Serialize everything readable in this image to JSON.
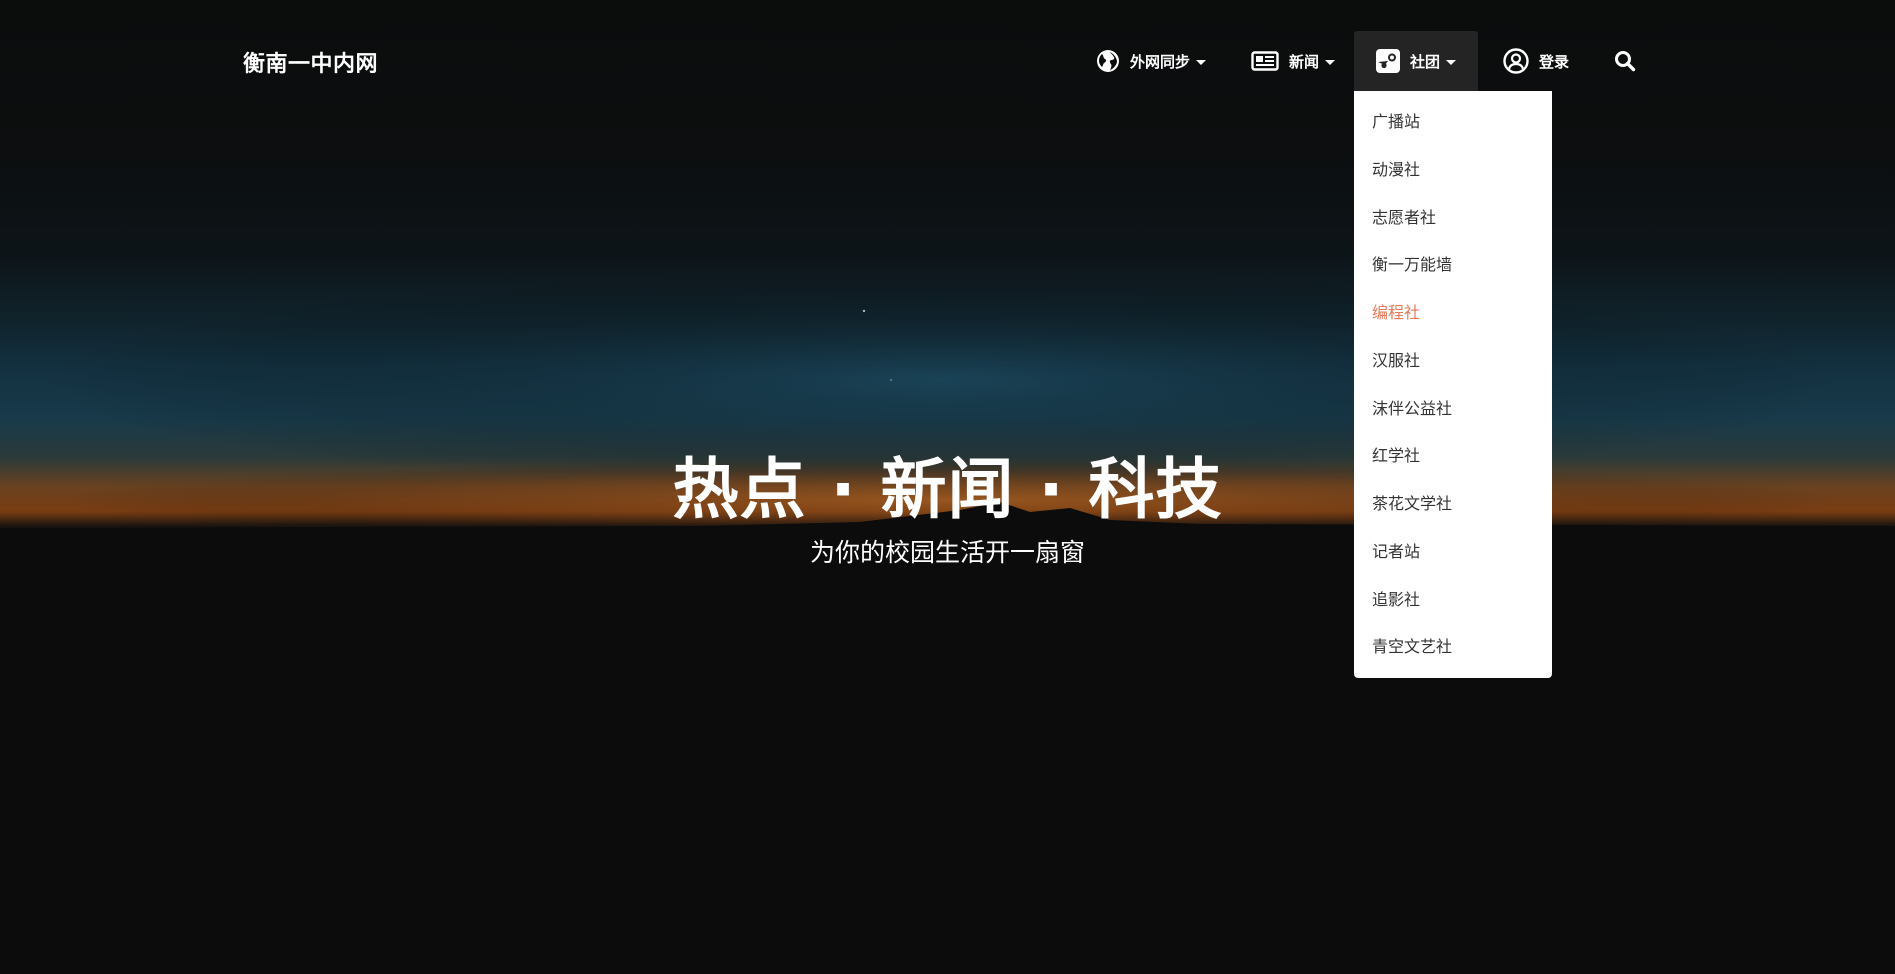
{
  "brand": {
    "title": "衡南一中内网"
  },
  "nav": {
    "items": [
      {
        "label": "外网同步",
        "icon": "globe-icon",
        "has_dropdown": true
      },
      {
        "label": "新闻",
        "icon": "newspaper-icon",
        "has_dropdown": true
      },
      {
        "label": "社团",
        "icon": "steam-icon",
        "has_dropdown": true,
        "active": true
      },
      {
        "label": "登录",
        "icon": "user-circle-icon",
        "has_dropdown": false
      }
    ],
    "search_icon": "search-icon"
  },
  "dropdown": {
    "items": [
      "广播站",
      "动漫社",
      "志愿者社",
      "衡一万能墙",
      "编程社",
      "汉服社",
      "沫伴公益社",
      "红学社",
      "茶花文学社",
      "记者站",
      "追影社",
      "青空文艺社"
    ],
    "highlighted_item": "编程社"
  },
  "hero": {
    "title": "热点 · 新闻 · 科技",
    "subtitle": "为你的校园生活开一扇窗"
  },
  "colors": {
    "background": "#0a0b0a",
    "active_nav_bg": "#232423",
    "dropdown_bg": "#ffffff",
    "dropdown_text": "#333333",
    "highlight": "#e8795a"
  }
}
